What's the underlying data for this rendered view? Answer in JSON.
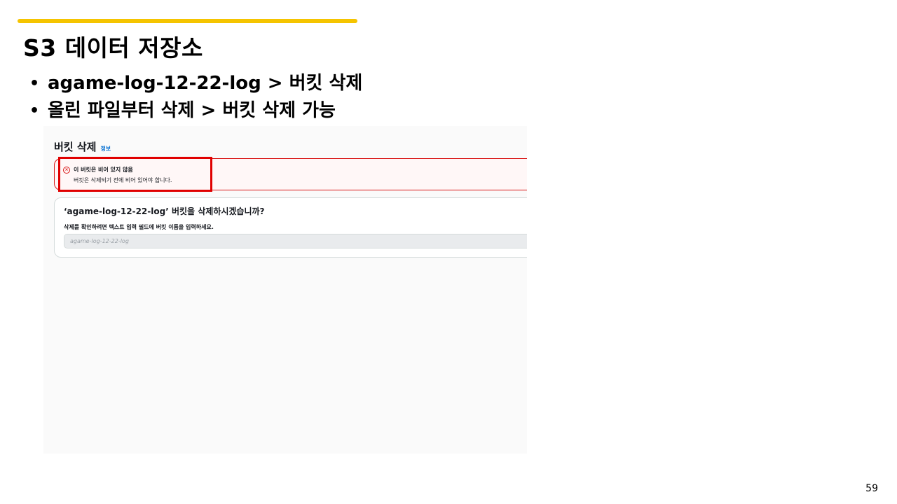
{
  "slide": {
    "title": "S3 데이터 저장소",
    "bullets": [
      "agame-log-12-22-log > 버킷 삭제",
      "올린 파일부터 삭제 > 버킷 삭제 가능"
    ],
    "bullet_symbol": "•",
    "page_number": "59",
    "accent_color": "#f5c400"
  },
  "console": {
    "panel_title": "버킷 삭제",
    "info_link": "정보",
    "alert": {
      "icon": "error-x-circle-icon",
      "icon_glyph": "×",
      "heading": "이 버킷은 비어 있지 않음",
      "message": "버킷은 삭제되기 전에 비어 있어야 합니다.",
      "color": "#d91515"
    },
    "confirm": {
      "question": "‘agame-log-12-22-log’ 버킷을 삭제하시겠습니까?",
      "instruction": "삭제를 확인하려면 텍스트 입력 필드에 버킷 이름을 입력하세요.",
      "input_placeholder": "agame-log-12-22-log",
      "input_value": ""
    },
    "highlight_color": "#e00000"
  }
}
